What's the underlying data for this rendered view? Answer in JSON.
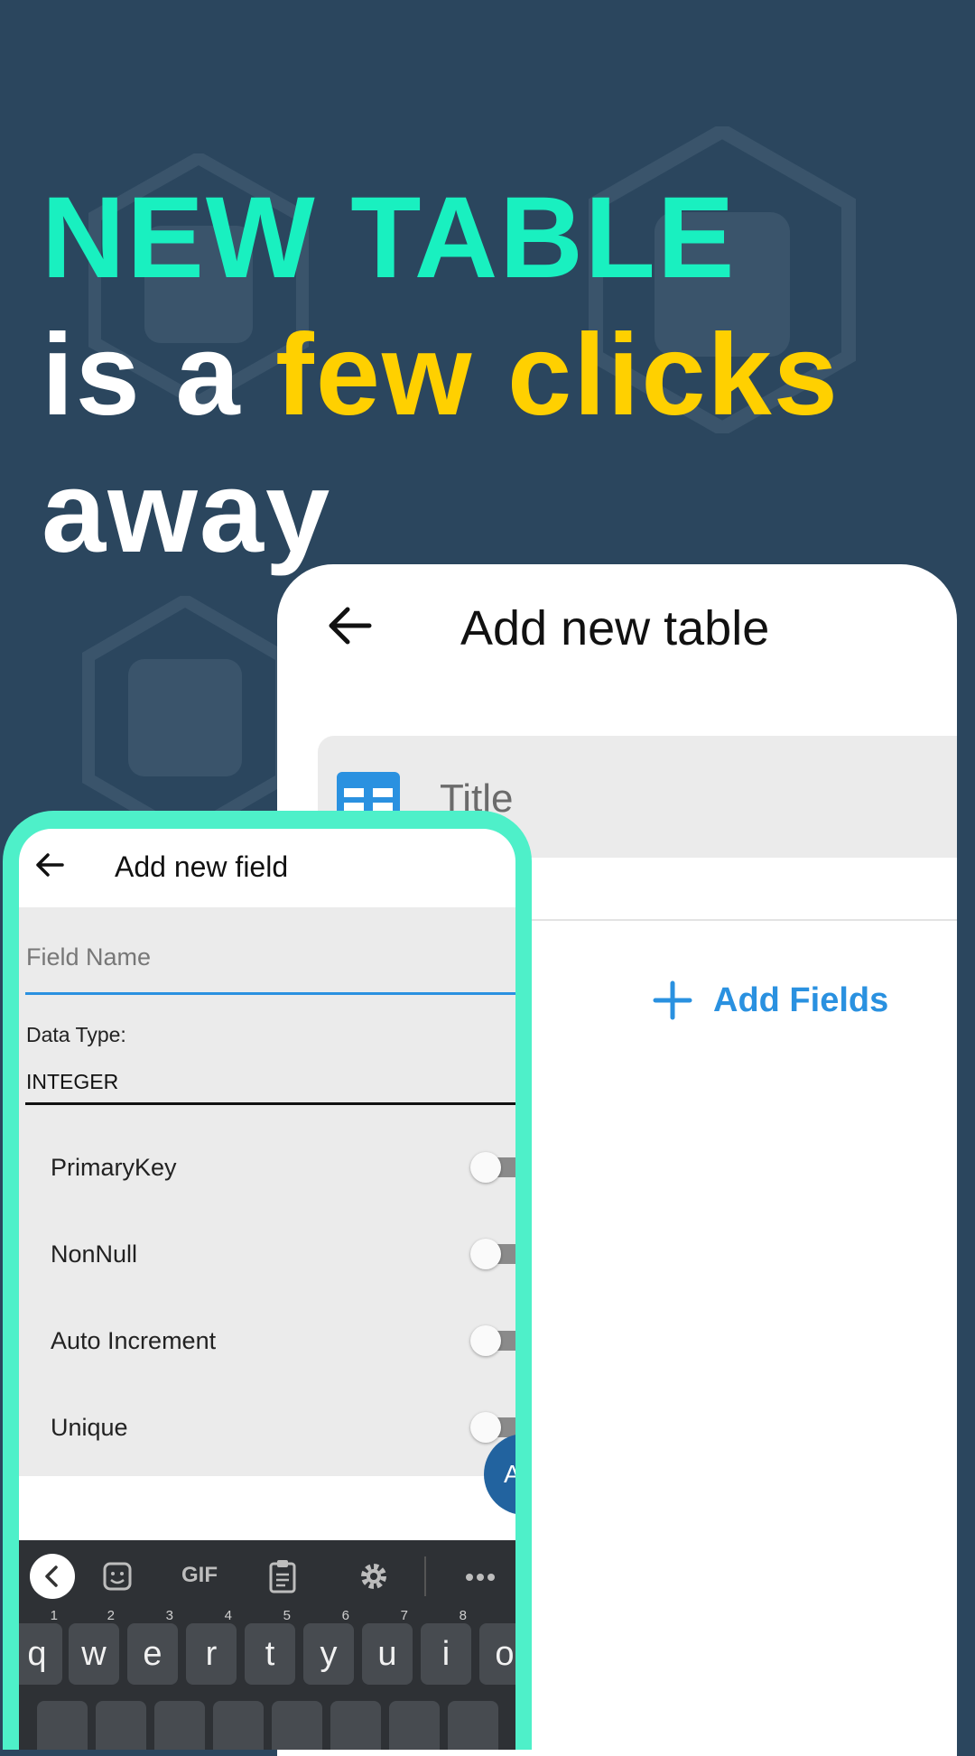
{
  "headline": {
    "line1": "NEW TABLE",
    "line2_prefix": "is a ",
    "line2_accent": "few clicks",
    "line3": "away"
  },
  "colors": {
    "background": "#2b465e",
    "headline_teal": "#19f0c0",
    "headline_yellow": "#ffd000",
    "phone_frame": "#4ef0c9",
    "accent_blue": "#2a91e0",
    "fab_blue": "#22639f"
  },
  "table_screen": {
    "back_icon": "arrow-left-icon",
    "title": "Add new table",
    "title_field_icon": "table-icon",
    "title_field_placeholder": "Title",
    "add_fields_icon": "plus-icon",
    "add_fields_label": "Add Fields"
  },
  "field_screen": {
    "back_icon": "arrow-left-icon",
    "title": "Add new field",
    "field_name_placeholder": "Field Name",
    "data_type_label": "Data Type:",
    "data_type_value": "INTEGER",
    "toggles": [
      {
        "label": "PrimaryKey",
        "on": false
      },
      {
        "label": "NonNull",
        "on": false
      },
      {
        "label": "Auto Increment",
        "on": false
      },
      {
        "label": "Unique",
        "on": false
      }
    ],
    "fab_label": "A"
  },
  "keyboard": {
    "toolbar": [
      {
        "name": "collapse-icon"
      },
      {
        "name": "sticker-icon"
      },
      {
        "name": "gif-icon",
        "label": "GIF"
      },
      {
        "name": "clipboard-icon"
      },
      {
        "name": "settings-icon"
      },
      {
        "name": "more-icon"
      }
    ],
    "keys": [
      {
        "char": "q",
        "num": "1"
      },
      {
        "char": "w",
        "num": "2"
      },
      {
        "char": "e",
        "num": "3"
      },
      {
        "char": "r",
        "num": "4"
      },
      {
        "char": "t",
        "num": "5"
      },
      {
        "char": "y",
        "num": "6"
      },
      {
        "char": "u",
        "num": "7"
      },
      {
        "char": "i",
        "num": "8"
      },
      {
        "char": "o",
        "num": ""
      }
    ]
  }
}
